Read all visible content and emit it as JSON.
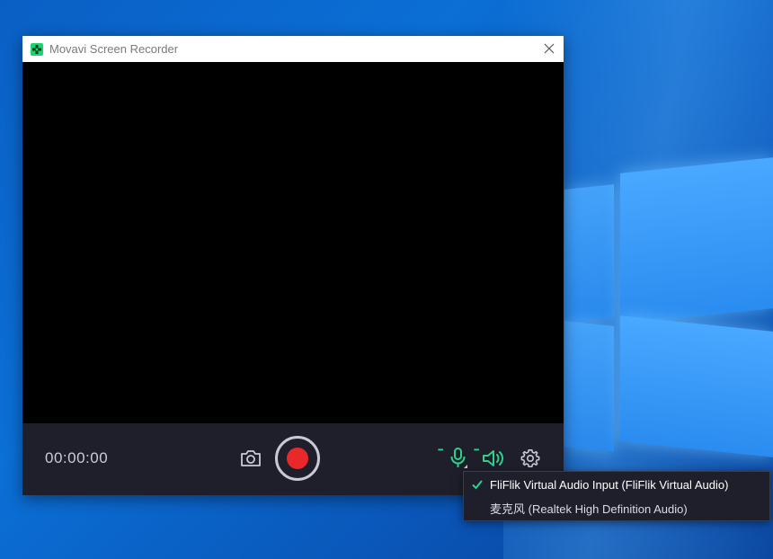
{
  "window": {
    "title": "Movavi Screen Recorder"
  },
  "controls": {
    "timer": "00:00:00"
  },
  "icons": {
    "app": "movavi-logo-icon",
    "close": "close-icon",
    "camera": "camera-icon",
    "record": "record-icon",
    "microphone": "microphone-icon",
    "speaker": "speaker-icon",
    "settings": "gear-icon",
    "check": "checkmark-icon"
  },
  "audio_menu": {
    "items": [
      {
        "label": "FliFlik Virtual Audio Input (FliFlik Virtual Audio)",
        "selected": true
      },
      {
        "label": "麦克风 (Realtek High Definition Audio)",
        "selected": false
      }
    ]
  },
  "colors": {
    "accent": "#2fd08a",
    "record": "#e8282b",
    "panel": "#1e1f2b",
    "desktop": "#0b6fd6"
  }
}
